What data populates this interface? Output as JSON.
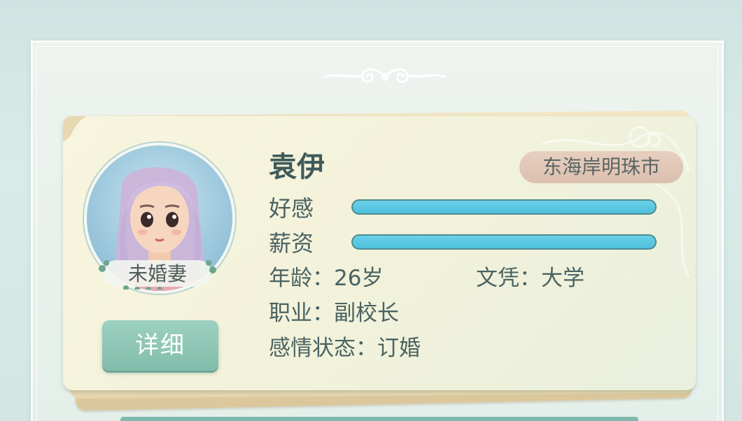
{
  "profile": {
    "name": "袁伊",
    "location": "东海岸明珠市",
    "relation": "未婚妻",
    "detail_button": "详细",
    "stats": {
      "affection_label": "好感",
      "affection_level": 1.0,
      "salary_label": "薪资",
      "salary_level": 1.0
    },
    "info": {
      "age": "年龄：26岁",
      "education": "文凭：大学",
      "job": "职业：副校长",
      "relationship_status": "感情状态：订婚"
    }
  },
  "colors": {
    "bar_fill": "#4ec0dd",
    "button": "#8ec6b5",
    "badge": "#e2c8b8",
    "name_text": "#3f5a5a"
  }
}
